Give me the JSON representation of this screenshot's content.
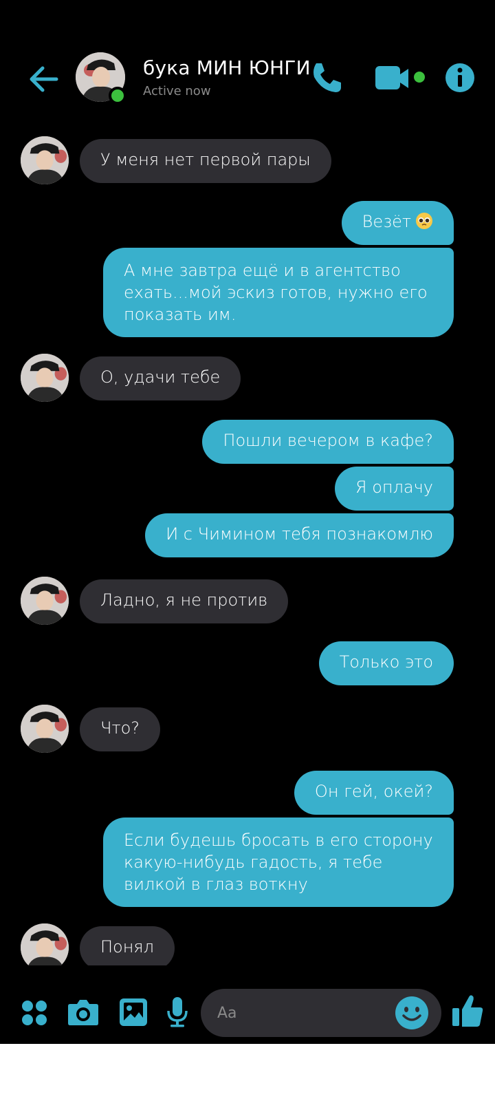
{
  "header": {
    "contact_name": "бука МИН ЮНГИ",
    "status": "Active now"
  },
  "messages": [
    {
      "from": "them",
      "text": "У меня нет первой пары"
    },
    {
      "from": "me",
      "text": "Везёт",
      "emoji": "pleading-face"
    },
    {
      "from": "me",
      "text": "А мне завтра ещё и в агентство ехать...мой эскиз готов, нужно его показать им."
    },
    {
      "from": "them",
      "text": "О, удачи тебе"
    },
    {
      "from": "me",
      "text": "Пошли вечером в кафе?"
    },
    {
      "from": "me",
      "text": "Я оплачу"
    },
    {
      "from": "me",
      "text": "И с Чимином тебя познакомлю"
    },
    {
      "from": "them",
      "text": "Ладно, я не против"
    },
    {
      "from": "me",
      "text": "Только это"
    },
    {
      "from": "them",
      "text": "Что?"
    },
    {
      "from": "me",
      "text": "Он гей, окей?"
    },
    {
      "from": "me",
      "text": "Если будешь бросать в его сторону какую-нибудь гадость, я тебе вилкой в глаз воткну"
    },
    {
      "from": "them",
      "text": "Понял"
    }
  ],
  "composer": {
    "placeholder": "Aa"
  },
  "colors": {
    "accent": "#39b0cc",
    "incoming_bubble": "#2f2e33",
    "background": "#000000",
    "online": "#3cc03e"
  },
  "icons": [
    "back-arrow-icon",
    "phone-icon",
    "video-camera-icon",
    "info-icon",
    "apps-grid-icon",
    "camera-icon",
    "gallery-icon",
    "microphone-icon",
    "smile-icon",
    "thumbs-up-icon"
  ]
}
